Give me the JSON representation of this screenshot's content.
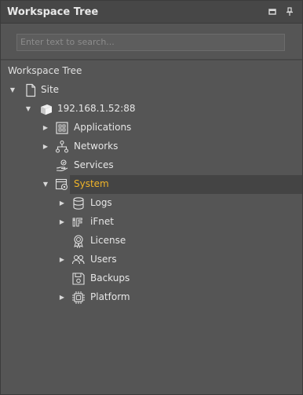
{
  "panel": {
    "title": "Workspace Tree",
    "pin_icon": "pin-icon",
    "maximize_icon": "window-maximize-icon"
  },
  "search": {
    "value": "",
    "placeholder": "Enter text to search..."
  },
  "section": {
    "title": "Workspace Tree"
  },
  "tree": {
    "site": {
      "label": "Site",
      "icon": "page-icon",
      "expanded": true
    },
    "device": {
      "label": "192.168.1.52:88",
      "icon": "device-box-icon",
      "expanded": true
    },
    "device_children": [
      {
        "label": "Applications",
        "icon": "applications-icon",
        "has_children": true,
        "expanded": false
      },
      {
        "label": "Networks",
        "icon": "networks-icon",
        "has_children": true,
        "expanded": false
      },
      {
        "label": "Services",
        "icon": "services-icon",
        "has_children": false
      },
      {
        "label": "System",
        "icon": "system-icon",
        "has_children": true,
        "expanded": true,
        "selected": true
      }
    ],
    "system_children": [
      {
        "label": "Logs",
        "icon": "database-icon",
        "has_children": true
      },
      {
        "label": "iFnet",
        "icon": "ifnet-icon",
        "has_children": true
      },
      {
        "label": "License",
        "icon": "license-badge-icon",
        "has_children": false
      },
      {
        "label": "Users",
        "icon": "users-icon",
        "has_children": true
      },
      {
        "label": "Backups",
        "icon": "save-disk-icon",
        "has_children": false
      },
      {
        "label": "Platform",
        "icon": "chip-icon",
        "has_children": true
      }
    ]
  },
  "colors": {
    "selected_text": "#f0b429",
    "text": "#e6e6e6",
    "panel_bg": "#555555",
    "title_bg": "#474747"
  }
}
